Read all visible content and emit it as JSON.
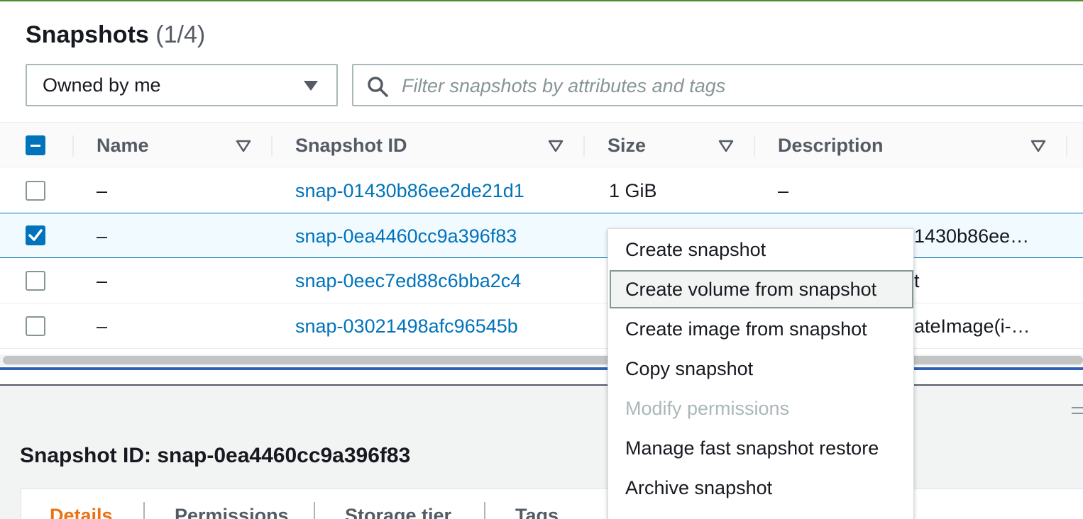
{
  "header": {
    "title": "Snapshots",
    "count": "(1/4)"
  },
  "filters": {
    "owner_select_value": "Owned by me",
    "search_placeholder": "Filter snapshots by attributes and tags"
  },
  "table": {
    "columns": [
      "Name",
      "Snapshot ID",
      "Size",
      "Description"
    ],
    "rows": [
      {
        "name": "–",
        "snapshot_id": "snap-01430b86ee2de21d1",
        "size": "1 GiB",
        "description": "–",
        "checked": false
      },
      {
        "name": "–",
        "snapshot_id": "snap-0ea4460cc9a396f83",
        "size": "",
        "description": "1430b86ee…",
        "checked": true
      },
      {
        "name": "–",
        "snapshot_id": "snap-0eec7ed88c6bba2c4",
        "size": "",
        "description": "t",
        "checked": false
      },
      {
        "name": "–",
        "snapshot_id": "snap-03021498afc96545b",
        "size": "",
        "description": "ateImage(i-…",
        "checked": false
      }
    ]
  },
  "context_menu": {
    "items": [
      {
        "label": "Create snapshot",
        "state": "normal"
      },
      {
        "label": "Create volume from snapshot",
        "state": "highlighted"
      },
      {
        "label": "Create image from snapshot",
        "state": "normal"
      },
      {
        "label": "Copy snapshot",
        "state": "normal"
      },
      {
        "label": "Modify permissions",
        "state": "disabled"
      },
      {
        "label": "Manage fast snapshot restore",
        "state": "normal"
      },
      {
        "label": "Archive snapshot",
        "state": "normal"
      }
    ]
  },
  "details": {
    "title": "Snapshot ID: snap-0ea4460cc9a396f83",
    "tabs": [
      "Details",
      "Permissions",
      "Storage tier",
      "Tags"
    ],
    "active_tab": "Details"
  },
  "colors": {
    "link": "#0073bb",
    "active_tab": "#ec7211",
    "selected_row_bg": "#f1faff"
  }
}
